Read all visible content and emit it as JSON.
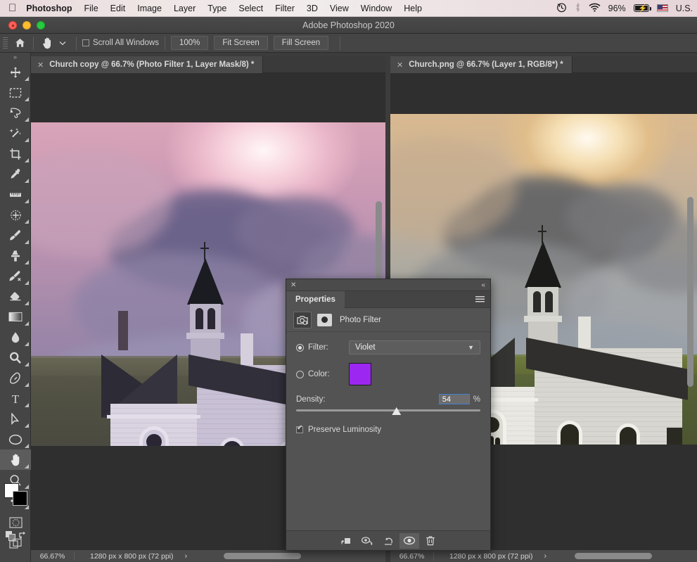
{
  "menubar": {
    "apple_icon": "apple-icon",
    "items": [
      "Photoshop",
      "File",
      "Edit",
      "Image",
      "Layer",
      "Type",
      "Select",
      "Filter",
      "3D",
      "View",
      "Window",
      "Help"
    ],
    "status": {
      "time_machine_icon": "time-machine-icon",
      "bluetooth_icon": "bluetooth-icon",
      "wifi_icon": "wifi-icon",
      "battery_percent": "96%",
      "battery_icon": "battery-charging-icon",
      "flag_icon": "us-flag-icon",
      "input_source": "U.S."
    }
  },
  "window": {
    "title": "Adobe Photoshop 2020",
    "close_label": "close-window",
    "minimize_label": "minimize-window",
    "zoom_label": "zoom-window"
  },
  "options_bar": {
    "home_icon": "home-icon",
    "tool_icon": "hand-tool-icon",
    "tool_preset_chevron": "chevron-down-icon",
    "scroll_all_windows": {
      "label": "Scroll All Windows",
      "checked": false
    },
    "buttons": [
      "100%",
      "Fit Screen",
      "Fill Screen"
    ]
  },
  "tools": [
    {
      "name": "move-tool",
      "glyph": "move"
    },
    {
      "name": "rectangular-marquee-tool",
      "glyph": "marquee"
    },
    {
      "name": "lasso-tool",
      "glyph": "lasso"
    },
    {
      "name": "object-selection-tool",
      "glyph": "wand"
    },
    {
      "name": "crop-tool",
      "glyph": "crop"
    },
    {
      "name": "eyedropper-tool",
      "glyph": "eyedropper"
    },
    {
      "name": "ruler-tool",
      "glyph": "ruler"
    },
    {
      "name": "spot-healing-brush-tool",
      "glyph": "healing"
    },
    {
      "name": "brush-tool",
      "glyph": "brush"
    },
    {
      "name": "clone-stamp-tool",
      "glyph": "stamp"
    },
    {
      "name": "history-brush-tool",
      "glyph": "historybrush"
    },
    {
      "name": "eraser-tool",
      "glyph": "eraser"
    },
    {
      "name": "gradient-tool",
      "glyph": "gradient"
    },
    {
      "name": "blur-tool",
      "glyph": "blur"
    },
    {
      "name": "dodge-tool",
      "glyph": "dodge"
    },
    {
      "name": "pen-tool",
      "glyph": "pen"
    },
    {
      "name": "type-tool",
      "glyph": "type"
    },
    {
      "name": "path-selection-tool",
      "glyph": "pathselect"
    },
    {
      "name": "ellipse-tool",
      "glyph": "ellipse"
    },
    {
      "name": "hand-tool",
      "glyph": "hand",
      "active": true
    },
    {
      "name": "zoom-tool",
      "glyph": "zoom"
    },
    {
      "name": "edit-toolbar-tool",
      "glyph": "more"
    }
  ],
  "tool_footer": {
    "foreground_color": "#ffffff",
    "background_color": "#000000",
    "default_colors_icon": "default-colors-icon",
    "swap_colors_icon": "swap-colors-icon",
    "quick_mask_icon": "quick-mask-icon",
    "screen_mode_icon": "screen-mode-icon"
  },
  "documents": [
    {
      "tab_label": "Church copy @ 66.7% (Photo Filter 1, Layer Mask/8) *",
      "close_icon": "close-tab-icon",
      "zoom": "66.67%",
      "dimensions": "1280 px x 800 px (72 ppi)",
      "status_arrow": "›",
      "filtered": true
    },
    {
      "tab_label": "Church.png @ 66.7% (Layer 1, RGB/8*) *",
      "close_icon": "close-tab-icon",
      "zoom": "66.67%",
      "dimensions": "1280 px x 800 px (72 ppi)",
      "status_arrow": "›",
      "filtered": false
    }
  ],
  "properties_panel": {
    "close_icon": "close-panel-icon",
    "collapse_icon": "collapse-to-icons-icon",
    "tab_label": "Properties",
    "menu_icon": "panel-menu-icon",
    "adjustment_icon": "photo-filter-icon",
    "mask_thumbnail_icon": "layer-mask-thumbnail-icon",
    "adjustment_name": "Photo Filter",
    "filter_radio": {
      "label": "Filter:",
      "selected": true
    },
    "filter_value": "Violet",
    "filter_chevron_icon": "chevron-down-icon",
    "color_radio": {
      "label": "Color:",
      "selected": false
    },
    "color_swatch": "#9c27f0",
    "density": {
      "label": "Density:",
      "value": "54",
      "unit": "%",
      "percent": 54
    },
    "preserve_luminosity": {
      "label": "Preserve Luminosity",
      "checked": true
    },
    "footer_buttons": [
      {
        "name": "clip-to-layer-button",
        "icon": "clip-to-layer-icon",
        "selected": false
      },
      {
        "name": "toggle-layer-visibility-previous-button",
        "icon": "view-previous-state-icon",
        "selected": false
      },
      {
        "name": "reset-adjustment-button",
        "icon": "reset-icon",
        "selected": false
      },
      {
        "name": "toggle-layer-visibility-button",
        "icon": "eye-icon",
        "selected": true
      },
      {
        "name": "delete-adjustment-layer-button",
        "icon": "trash-icon",
        "selected": false
      }
    ]
  }
}
